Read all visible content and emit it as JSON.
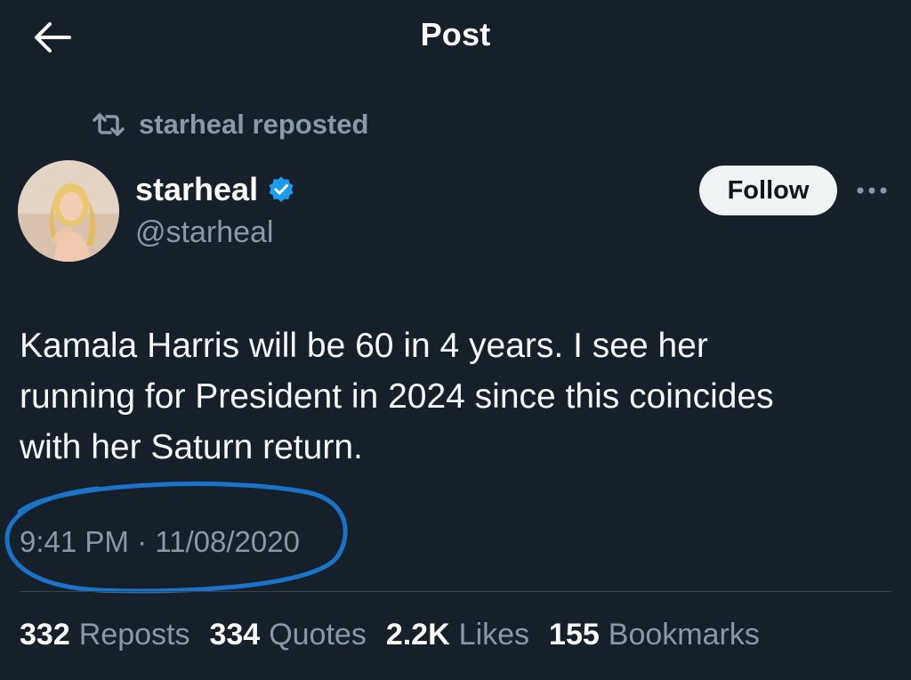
{
  "header": {
    "title": "Post"
  },
  "repost": {
    "text": "starheal reposted"
  },
  "author": {
    "display_name": "starheal",
    "handle": "@starheal",
    "verified": true
  },
  "follow_button": {
    "label": "Follow"
  },
  "tweet": {
    "lines": [
      "Kamala Harris will be 60 in 4 years. I see her",
      "running for President in 2024 since this coincides",
      "with her Saturn return."
    ],
    "timestamp": "9:41 PM · 11/08/2020"
  },
  "stats": [
    {
      "num": "332",
      "label": "Reposts"
    },
    {
      "num": "334",
      "label": "Quotes"
    },
    {
      "num": "2.2K",
      "label": "Likes"
    },
    {
      "num": "155",
      "label": "Bookmarks"
    }
  ],
  "colors": {
    "background": "#15202b",
    "secondary_text": "#8b98a5",
    "verified_badge": "#1d9bf0",
    "annotation_circle": "#1a73c9",
    "follow_button_bg": "#eff3f4"
  },
  "icons": {
    "back": "back-arrow-icon",
    "repost": "repost-icon",
    "verified": "verified-badge-icon",
    "more": "more-options-icon"
  }
}
